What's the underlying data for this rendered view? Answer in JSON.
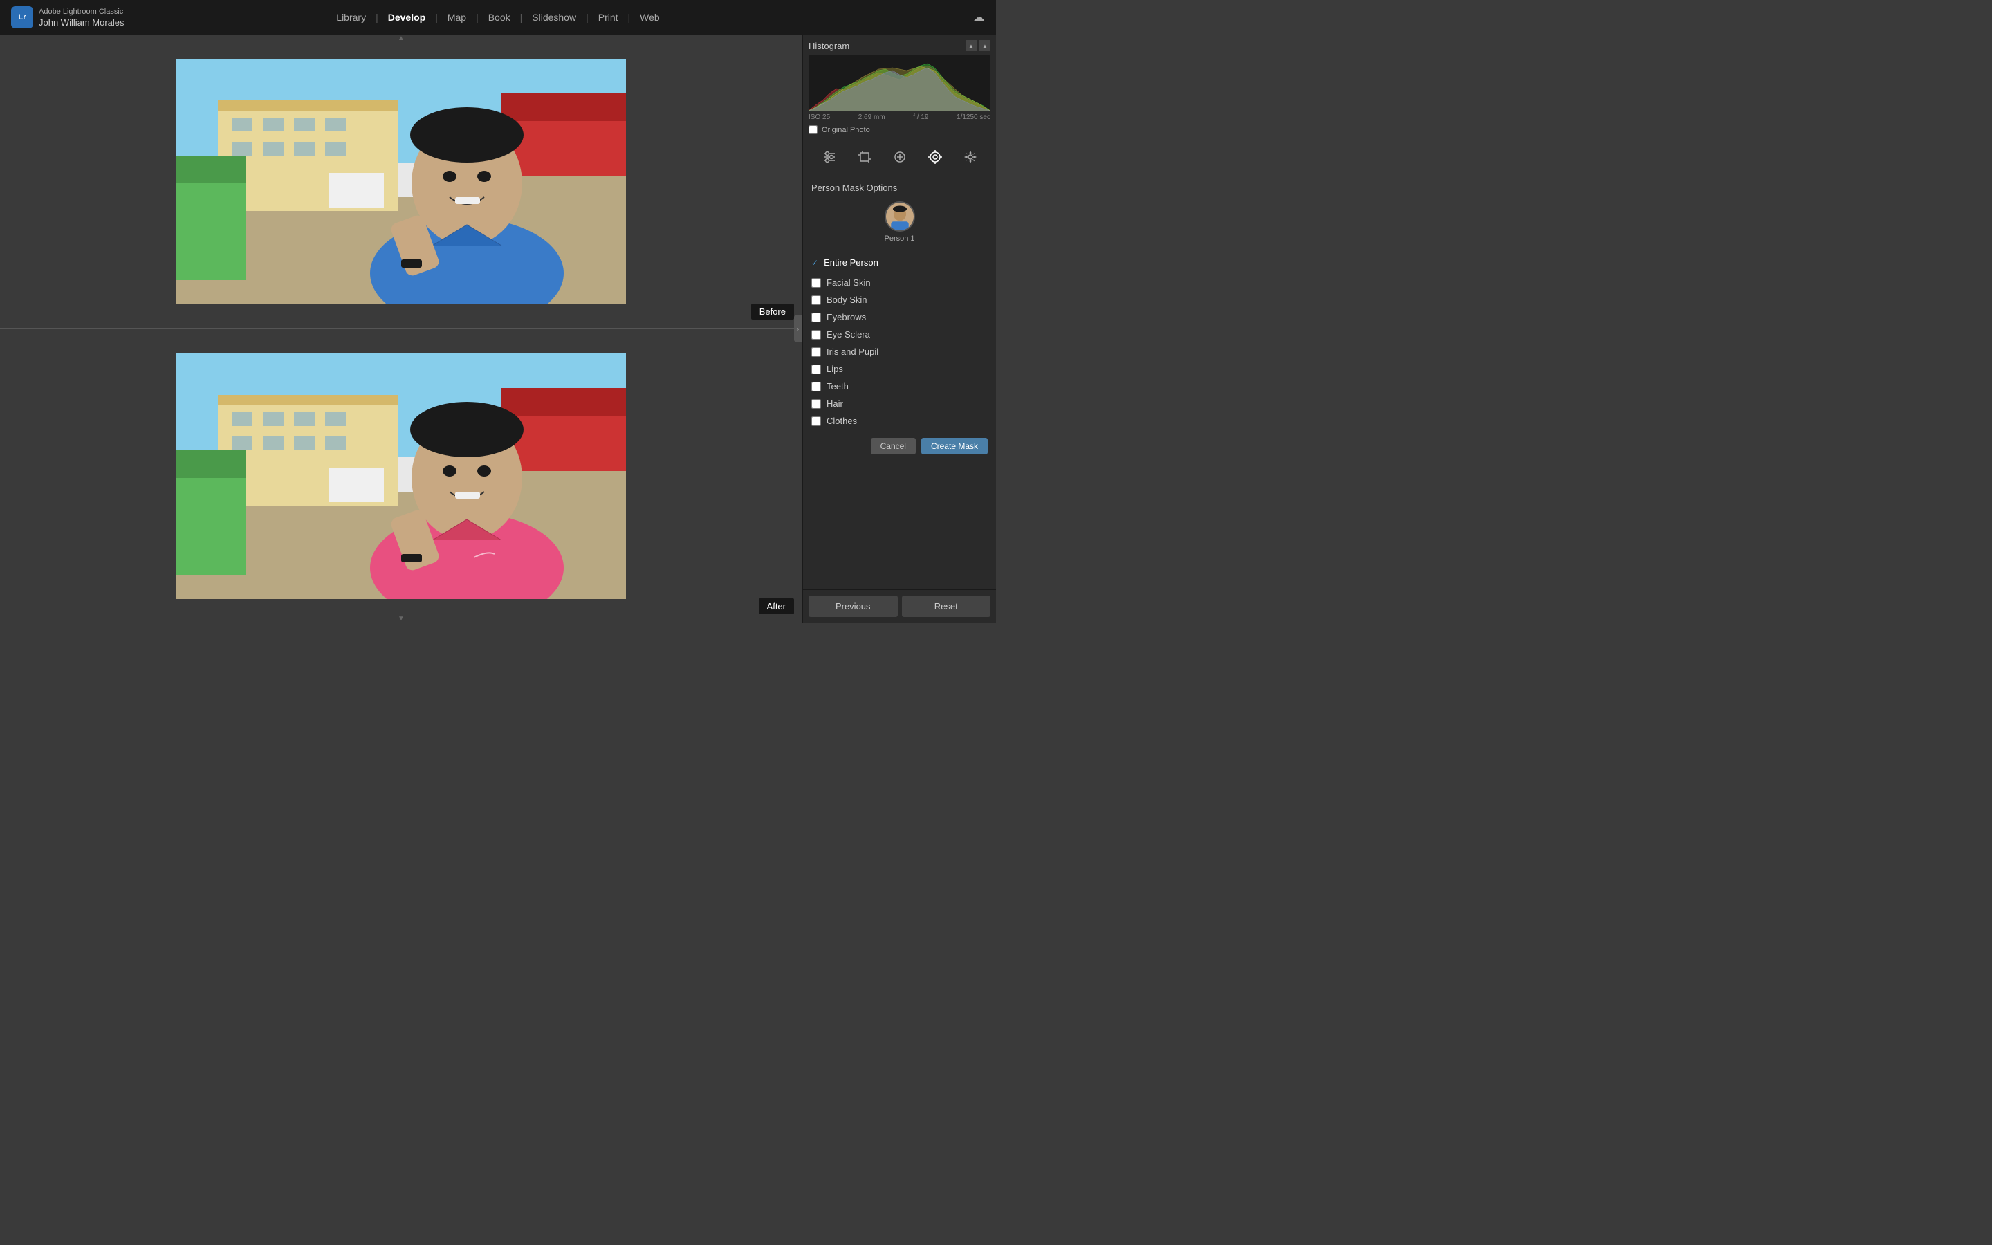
{
  "app": {
    "name": "Adobe Lightroom Classic",
    "user": "John William Morales",
    "logo": "Lr"
  },
  "nav": {
    "items": [
      {
        "label": "Library",
        "active": false
      },
      {
        "label": "Develop",
        "active": true
      },
      {
        "label": "Map",
        "active": false
      },
      {
        "label": "Book",
        "active": false
      },
      {
        "label": "Slideshow",
        "active": false
      },
      {
        "label": "Print",
        "active": false
      },
      {
        "label": "Web",
        "active": false
      }
    ]
  },
  "histogram": {
    "title": "Histogram",
    "iso": "ISO 25",
    "focal": "2.69 mm",
    "aperture": "f / 19",
    "shutter": "1/1250 sec",
    "original_photo_label": "Original Photo"
  },
  "tools": [
    {
      "name": "sliders-icon",
      "symbol": "⊞"
    },
    {
      "name": "crop-icon",
      "symbol": "⬡"
    },
    {
      "name": "heal-icon",
      "symbol": "✎"
    },
    {
      "name": "mask-icon",
      "symbol": "◉"
    },
    {
      "name": "settings-icon",
      "symbol": "⚙"
    }
  ],
  "mask_panel": {
    "title": "Person Mask Options",
    "person_label": "Person 1",
    "entire_person": "Entire Person",
    "options": [
      {
        "label": "Facial Skin",
        "checked": false
      },
      {
        "label": "Body Skin",
        "checked": false
      },
      {
        "label": "Eyebrows",
        "checked": false
      },
      {
        "label": "Eye Sclera",
        "checked": false
      },
      {
        "label": "Iris and Pupil",
        "checked": false
      },
      {
        "label": "Lips",
        "checked": false
      },
      {
        "label": "Teeth",
        "checked": false
      },
      {
        "label": "Hair",
        "checked": false
      },
      {
        "label": "Clothes",
        "checked": false
      }
    ],
    "cancel_label": "Cancel",
    "create_mask_label": "Create Mask"
  },
  "image_labels": {
    "before": "Before",
    "after": "After"
  },
  "bottom_buttons": {
    "previous": "Previous",
    "reset": "Reset"
  }
}
